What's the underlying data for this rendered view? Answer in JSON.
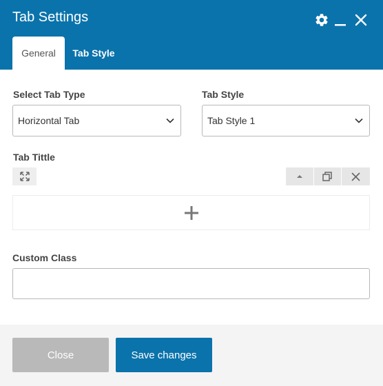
{
  "dialog": {
    "title": "Tab Settings",
    "colors": {
      "header": "#0b73ab",
      "primary_button": "#0b73ab",
      "disabled_button": "#b9b9b9"
    },
    "header_icons": [
      "gear-icon",
      "minimize-icon",
      "close-icon"
    ]
  },
  "tabs": [
    {
      "label": "General",
      "active": true
    },
    {
      "label": "Tab Style",
      "active": false
    }
  ],
  "form": {
    "tab_type": {
      "label": "Select Tab Type",
      "value": "Horizontal Tab"
    },
    "tab_style": {
      "label": "Tab Style",
      "value": "Tab Style 1"
    },
    "tab_title": {
      "label": "Tab Tittle",
      "toolbar_icons": [
        "expand-icon",
        "move-up-icon",
        "duplicate-icon",
        "remove-icon"
      ],
      "add_icon": "plus-icon"
    },
    "custom_class": {
      "label": "Custom Class",
      "value": "",
      "placeholder": ""
    }
  },
  "footer": {
    "close_label": "Close",
    "save_label": "Save changes"
  }
}
